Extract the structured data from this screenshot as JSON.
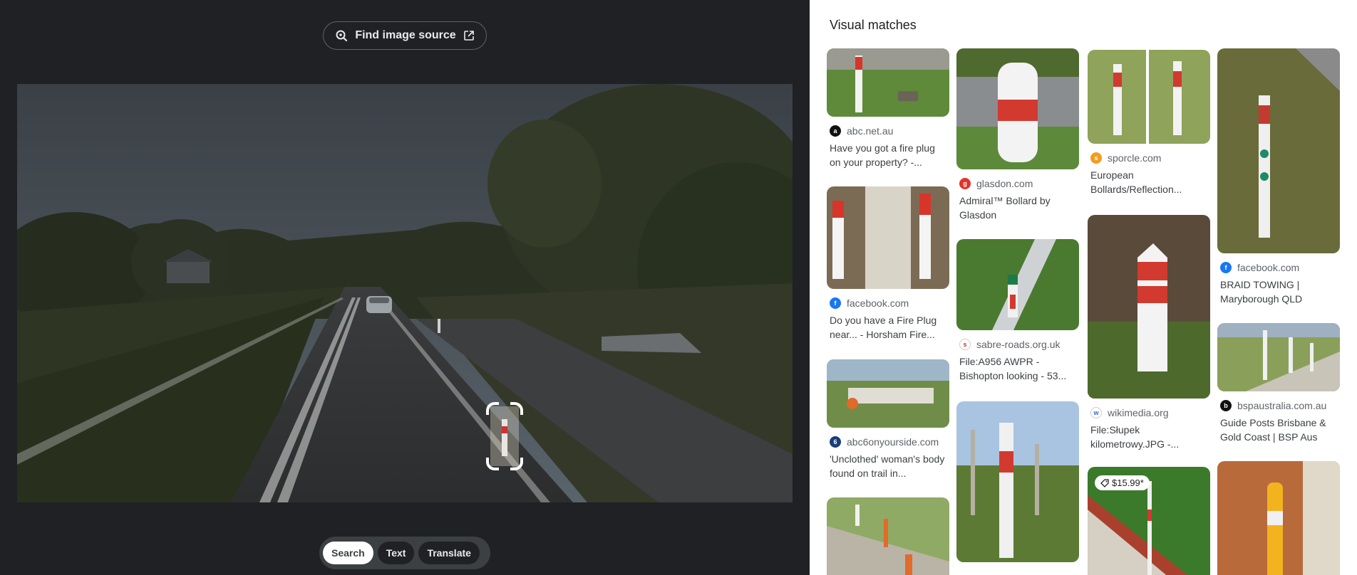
{
  "find_source": {
    "label": "Find image source"
  },
  "modes": {
    "search": "Search",
    "text": "Text",
    "translate": "Translate"
  },
  "panel": {
    "title": "Visual matches"
  },
  "cards": [
    {
      "source": "abc.net.au",
      "title": "Have you got a fire plug on your property? -..."
    },
    {
      "source": "facebook.com",
      "title": "Do you have a Fire Plug near... - Horsham Fire..."
    },
    {
      "source": "abc6onyourside.com",
      "title": "'Unclothed' woman's body found on trail in..."
    },
    {
      "source": "glasdon.com",
      "title": "Admiral™ Bollard by Glasdon"
    },
    {
      "source": "sabre-roads.org.uk",
      "title": "File:A956 AWPR - Bishopton looking - 53..."
    },
    {
      "source": "sporcle.com",
      "title": "European Bollards/Reflection..."
    },
    {
      "source": "wikimedia.org",
      "title": "File:Słupek kilometrowy.JPG -..."
    },
    {
      "price": "$15.99*"
    },
    {
      "source": "facebook.com",
      "title": "BRAID TOWING | Maryborough QLD"
    },
    {
      "source": "bspaustralia.com.au",
      "title": "Guide Posts Brisbane & Gold Coast | BSP Aus"
    }
  ],
  "colors": {
    "dark_bg": "#202124",
    "panel_bg": "#ffffff",
    "favicon_facebook": "#1877f2",
    "favicon_glasdon": "#e2342b",
    "favicon_sporcle": "#f29c1f"
  },
  "icons": [
    "lens-icon",
    "open-external-icon",
    "tag-icon"
  ]
}
